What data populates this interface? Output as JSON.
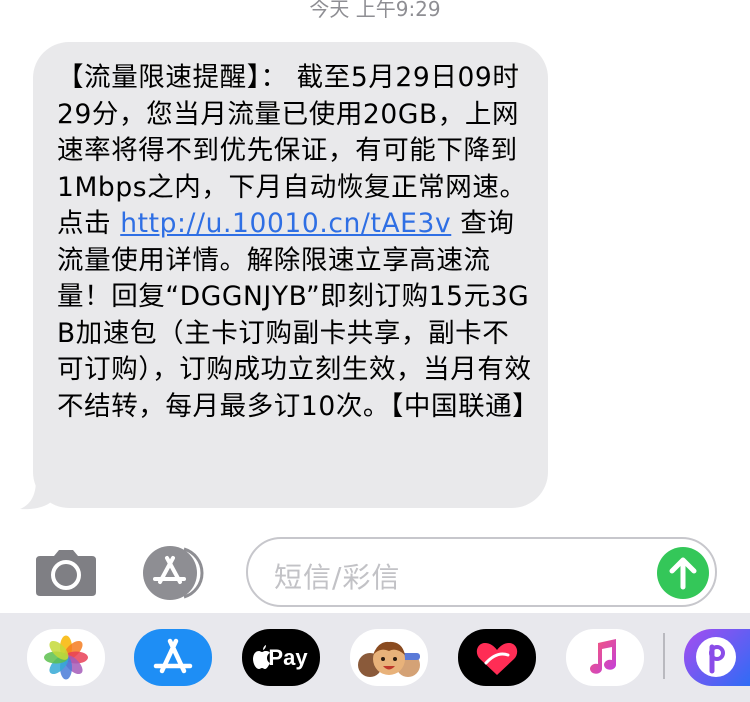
{
  "header": {
    "timestamp": "今天 上午9:29"
  },
  "message": {
    "text_before_link": "【流量限速提醒】： 截至5月29日09时29分，您当月流量已使用20GB，上网速率将得不到优先保证，有可能下降到1Mbps之内，下月自动恢复正常网速。点击 ",
    "link": "http://u.10010.cn/tAE3v",
    "text_after_link": " 查询流量使用详情。解除限速立享高速流量！回复“DGGNJYB”即刻订购15元3GB加速包（主卡订购副卡共享，副卡不可订购），订购成功立刻生效，当月有效不结转，每月最多订10次。【中国联通】"
  },
  "compose": {
    "placeholder": "短信/彩信"
  },
  "app_drawer": {
    "apple_pay_label": "Pay",
    "icons": [
      "photos-icon",
      "app-store-icon",
      "apple-pay-icon",
      "memoji-icon",
      "digital-touch-icon",
      "music-icon",
      "picsart-icon"
    ]
  },
  "colors": {
    "bubble": "#e9e9eb",
    "link": "#2f6fe4",
    "send": "#34c759",
    "drawer": "#e8e8ed"
  }
}
